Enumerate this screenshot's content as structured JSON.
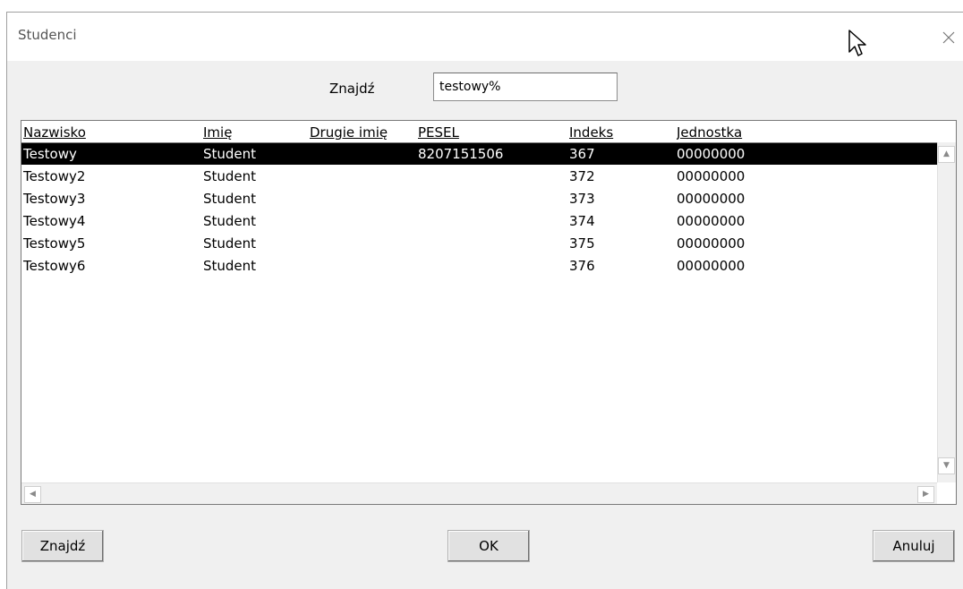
{
  "window": {
    "title": "Studenci"
  },
  "search": {
    "label": "Znajdź",
    "value": "testowy%"
  },
  "table": {
    "columns": [
      "Nazwisko",
      "Imię",
      "Drugie imię",
      "PESEL",
      "Indeks",
      "Jednostka"
    ],
    "rows": [
      [
        "Testowy",
        "Student",
        "",
        "8207151506",
        "367",
        "00000000"
      ],
      [
        "Testowy2",
        "Student",
        "",
        "",
        "372",
        "00000000"
      ],
      [
        "Testowy3",
        "Student",
        "",
        "",
        "373",
        "00000000"
      ],
      [
        "Testowy4",
        "Student",
        "",
        "",
        "374",
        "00000000"
      ],
      [
        "Testowy5",
        "Student",
        "",
        "",
        "375",
        "00000000"
      ],
      [
        "Testowy6",
        "Student",
        "",
        "",
        "376",
        "00000000"
      ]
    ],
    "selected_row": 0
  },
  "buttons": {
    "find": "Znajdź",
    "ok": "OK",
    "cancel": "Anuluj"
  },
  "icons": {
    "close": "close-icon",
    "cursor": "mouse-pointer-icon"
  }
}
